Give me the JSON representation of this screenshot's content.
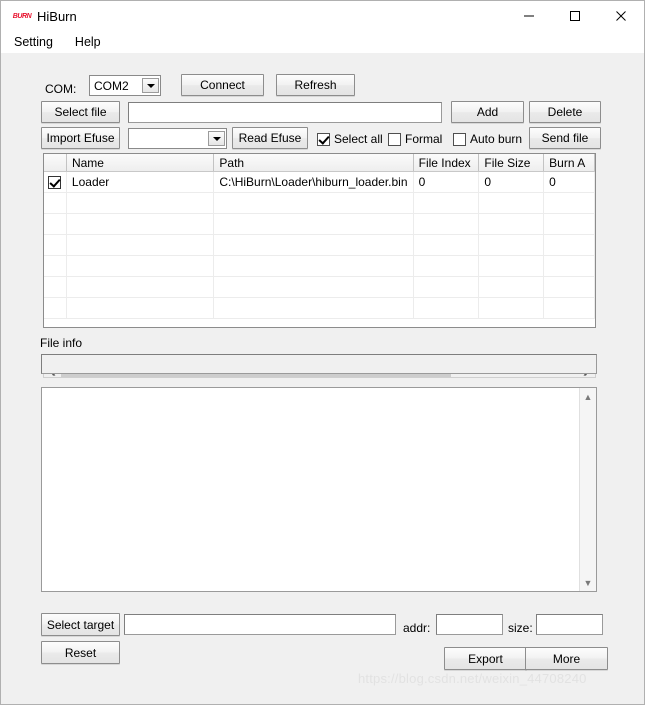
{
  "window": {
    "title": "HiBurn",
    "icon_label": "BURN",
    "controls": {
      "minimize": "minimize-icon",
      "maximize": "maximize-icon",
      "close": "close-icon"
    }
  },
  "menubar": {
    "items": [
      {
        "label": "Setting"
      },
      {
        "label": "Help"
      }
    ]
  },
  "toolbar": {
    "com_label": "COM:",
    "com_value": "COM2",
    "connect_label": "Connect",
    "refresh_label": "Refresh",
    "select_file_label": "Select file",
    "select_file_value": "",
    "add_label": "Add",
    "delete_label": "Delete",
    "import_efuse_label": "Import Efuse",
    "efuse_combo_value": "",
    "read_efuse_label": "Read Efuse",
    "select_all_label": "Select all",
    "select_all_checked": true,
    "formal_label": "Formal",
    "formal_checked": false,
    "auto_burn_label": "Auto burn",
    "auto_burn_checked": false,
    "send_file_label": "Send file"
  },
  "grid": {
    "columns": [
      {
        "key": "check",
        "label": ""
      },
      {
        "key": "name",
        "label": "Name"
      },
      {
        "key": "path",
        "label": "Path"
      },
      {
        "key": "file_index",
        "label": "File Index"
      },
      {
        "key": "file_size",
        "label": "File Size"
      },
      {
        "key": "burn_addr",
        "label": "Burn A"
      }
    ],
    "rows": [
      {
        "checked": true,
        "name": "Loader",
        "path": "C:\\HiBurn\\Loader\\hiburn_loader.bin",
        "file_index": "0",
        "file_size": "0",
        "burn_addr": "0"
      }
    ],
    "empty_row_count": 5,
    "hscroll": {
      "left_arrow": "chevron-left-icon",
      "right_arrow": "chevron-right-icon",
      "thumb_percent": 75
    }
  },
  "file_info": {
    "label": "File info",
    "value": ""
  },
  "log": {
    "value": "",
    "scroll_up": "chevron-up-icon",
    "scroll_down": "chevron-down-icon"
  },
  "footer": {
    "select_target_label": "Select target",
    "target_value": "",
    "reset_label": "Reset",
    "addr_label": "addr:",
    "addr_value": "",
    "size_label": "size:",
    "size_value": "",
    "export_label": "Export",
    "more_label": "More"
  },
  "watermark": {
    "text": "https://blog.csdn.net/weixin_44708240"
  }
}
